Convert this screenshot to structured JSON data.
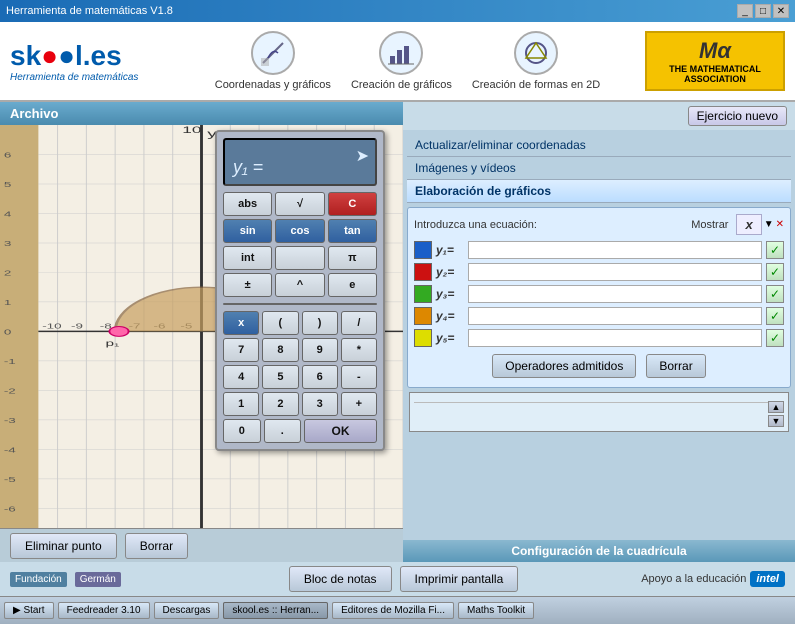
{
  "titleBar": {
    "title": "Herramienta de matemáticas V1.8",
    "controls": [
      "_",
      "□",
      "✕"
    ]
  },
  "logo": {
    "brand": "sk●●l.es",
    "subtitle": "Herramienta de matemáticas"
  },
  "navItems": [
    {
      "id": "coordenadas",
      "label": "Coordenadas y gráficos"
    },
    {
      "id": "creacion-graficos",
      "label": "Creación de gráficos"
    },
    {
      "id": "creacion-formas",
      "label": "Creación de formas en 2D"
    }
  ],
  "mathAssoc": {
    "symbol": "Mα",
    "label": "THE MATHEMATICAL ASSOCIATION"
  },
  "leftPanel": {
    "archivoLabel": "Archivo",
    "eliminarBtn": "Eliminar punto",
    "borrarBtn": "Borrar"
  },
  "calculator": {
    "displayText": "y₁ =",
    "buttons": {
      "row1": [
        "abs",
        "√",
        "C"
      ],
      "row2": [
        "sin",
        "cos",
        "tan"
      ],
      "row3": [
        "int",
        "",
        "π"
      ],
      "row4": [
        "±",
        "^",
        "e"
      ],
      "row5": [
        "x",
        "(",
        ")",
        "/"
      ],
      "row6": [
        "7",
        "8",
        "9",
        "*"
      ],
      "row7": [
        "4",
        "5",
        "6",
        "-"
      ],
      "row8": [
        "1",
        "2",
        "3",
        "+"
      ],
      "row9": [
        "0",
        ".",
        "OK"
      ]
    }
  },
  "rightPanel": {
    "ejercicioBtn": "Ejercicio nuevo",
    "menuItems": [
      {
        "id": "actualizar",
        "label": "Actualizar/eliminar coordenadas",
        "active": false
      },
      {
        "id": "imagenes",
        "label": "Imágenes y vídeos",
        "active": false
      },
      {
        "id": "elaboracion",
        "label": "Elaboración de gráficos",
        "active": true
      }
    ],
    "equationPanel": {
      "introLabel": "Introduzca una ecuación:",
      "mostrarLabel": "Mostrar",
      "xLabel": "x",
      "yRows": [
        {
          "id": "y1",
          "label": "y₁=",
          "color": "#1a5fc8",
          "value": "",
          "checked": true
        },
        {
          "id": "y2",
          "label": "y₂=",
          "color": "#cc1111",
          "value": "",
          "checked": true
        },
        {
          "id": "y3",
          "label": "y₃=",
          "color": "#33aa22",
          "value": "",
          "checked": true
        },
        {
          "id": "y4",
          "label": "y₄=",
          "color": "#dd8800",
          "value": "",
          "checked": true
        },
        {
          "id": "y5",
          "label": "y₅=",
          "color": "#dddd00",
          "value": "",
          "checked": true
        }
      ],
      "operadoresBtn": "Operadores admitidos",
      "borrarBtn": "Borrar"
    },
    "configLabel": "Configuración de la cuadrícula"
  },
  "bottomBar": {
    "tags": [
      "Fundación",
      "Germán"
    ],
    "blocNotas": "Bloc de notas",
    "imprimirBtn": "Imprimir pantalla",
    "apoyoLabel": "Apoyo a la educación",
    "intelLabel": "intel"
  },
  "taskbar": {
    "items": [
      {
        "label": "Feedreader 3.10",
        "active": false
      },
      {
        "label": "Descargas",
        "active": false
      },
      {
        "label": "skool.es :: Herran...",
        "active": true
      },
      {
        "label": "Editores de Mozilla Fi...",
        "active": false
      },
      {
        "label": "Maths Toolkit",
        "active": false
      }
    ]
  }
}
